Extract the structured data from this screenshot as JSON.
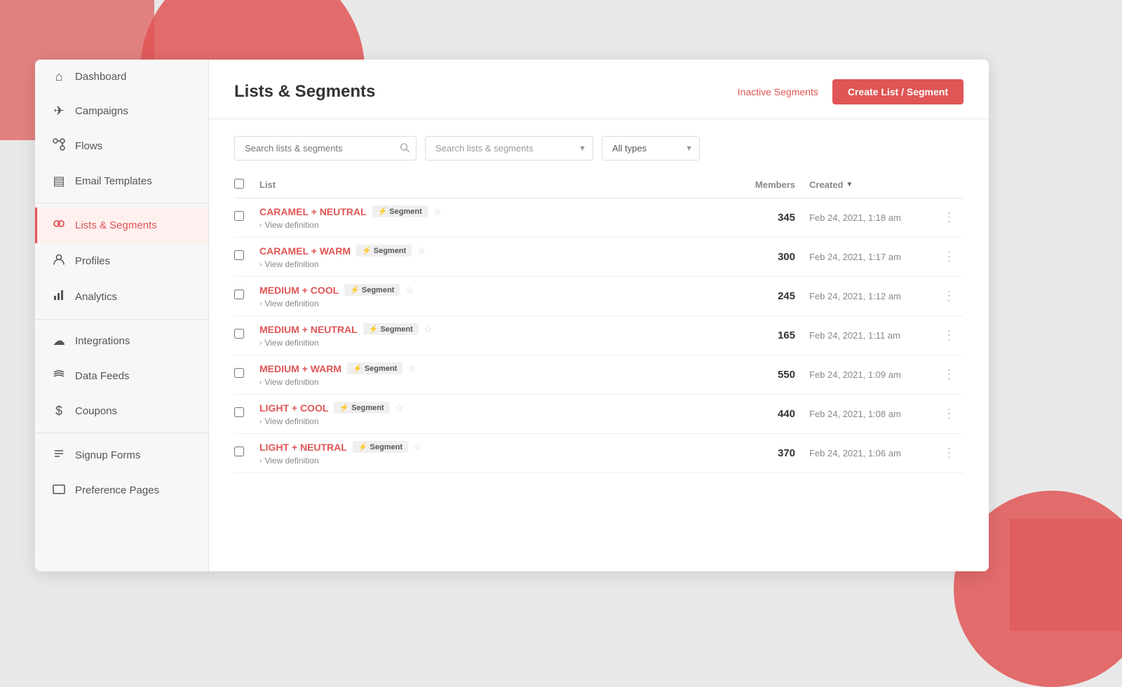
{
  "app": {
    "title": "Lists & Segments"
  },
  "header": {
    "inactive_segments_label": "Inactive Segments",
    "create_button_label": "Create List / Segment"
  },
  "search": {
    "placeholder1": "Search lists & segments",
    "placeholder2": "Search lists & segments",
    "type_default": "All types"
  },
  "table": {
    "col_list": "List",
    "col_members": "Members",
    "col_created": "Created",
    "rows": [
      {
        "name": "CARAMEL + NEUTRAL",
        "badge": "Segment",
        "members": "345",
        "created": "Feb 24, 2021, 1:18 am",
        "view_def": "View definition"
      },
      {
        "name": "CARAMEL + WARM",
        "badge": "Segment",
        "members": "300",
        "created": "Feb 24, 2021, 1:17 am",
        "view_def": "View definition"
      },
      {
        "name": "MEDIUM + COOL",
        "badge": "Segment",
        "members": "245",
        "created": "Feb 24, 2021, 1:12 am",
        "view_def": "View definition"
      },
      {
        "name": "MEDIUM + NEUTRAL",
        "badge": "Segment",
        "members": "165",
        "created": "Feb 24, 2021, 1:11 am",
        "view_def": "View definition"
      },
      {
        "name": "MEDIUM + WARM",
        "badge": "Segment",
        "members": "550",
        "created": "Feb 24, 2021, 1:09 am",
        "view_def": "View definition"
      },
      {
        "name": "LIGHT + COOL",
        "badge": "Segment",
        "members": "440",
        "created": "Feb 24, 2021, 1:08 am",
        "view_def": "View definition"
      },
      {
        "name": "LIGHT + NEUTRAL",
        "badge": "Segment",
        "members": "370",
        "created": "Feb 24, 2021, 1:06 am",
        "view_def": "View definition"
      }
    ]
  },
  "sidebar": {
    "items": [
      {
        "label": "Dashboard",
        "icon": "⌂",
        "key": "dashboard"
      },
      {
        "label": "Campaigns",
        "icon": "✈",
        "key": "campaigns"
      },
      {
        "label": "Flows",
        "icon": "♟",
        "key": "flows"
      },
      {
        "label": "Email Templates",
        "icon": "▤",
        "key": "email-templates"
      },
      {
        "label": "Lists & Segments",
        "icon": "👥",
        "key": "lists-segments",
        "active": true
      },
      {
        "label": "Profiles",
        "icon": "👤",
        "key": "profiles"
      },
      {
        "label": "Analytics",
        "icon": "📊",
        "key": "analytics"
      },
      {
        "label": "Integrations",
        "icon": "☁",
        "key": "integrations"
      },
      {
        "label": "Data Feeds",
        "icon": "📡",
        "key": "data-feeds"
      },
      {
        "label": "Coupons",
        "icon": "$",
        "key": "coupons"
      },
      {
        "label": "Signup Forms",
        "icon": "≡",
        "key": "signup-forms"
      },
      {
        "label": "Preference Pages",
        "icon": "▭",
        "key": "preference-pages"
      }
    ]
  }
}
